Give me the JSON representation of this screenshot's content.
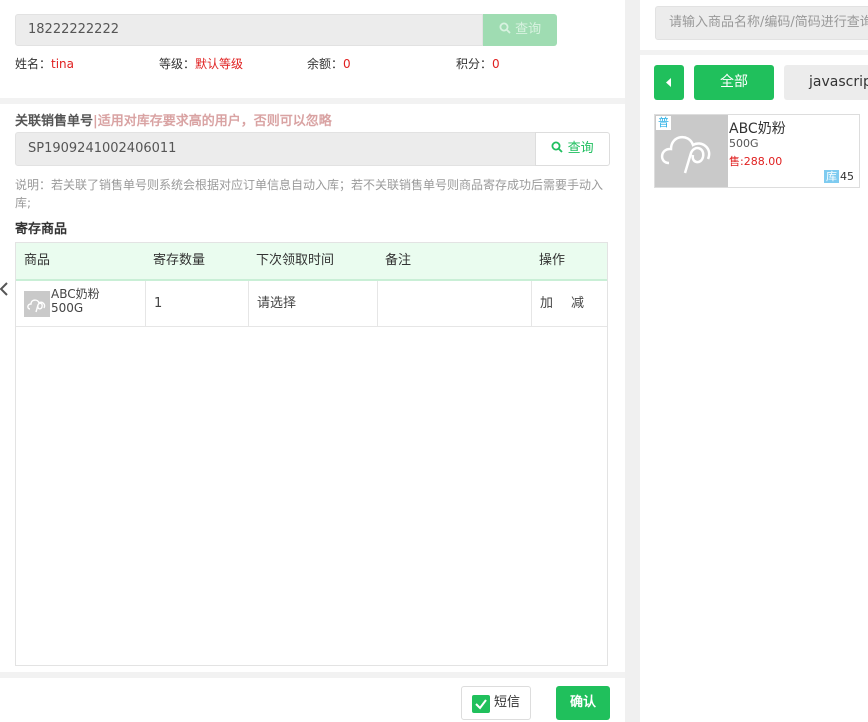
{
  "member": {
    "phone_value": "18222222222",
    "query_label": "查询",
    "name_label": "姓名：",
    "name_value": "tina",
    "level_label": "等级：",
    "level_value": "默认等级",
    "balance_label": "余额：",
    "balance_value": "0",
    "points_label": "积分：",
    "points_value": "0"
  },
  "sales_order": {
    "label": "关联销售单号",
    "hint": "|适用对库存要求高的用户，否则可以忽略",
    "value": "SP1909241002406011",
    "query_label": "查询",
    "note": "说明：若关联了销售单号则系统会根据对应订单信息自动入库；若不关联销售单号则商品寄存成功后需要手动入库;"
  },
  "stored": {
    "title": "寄存商品",
    "headers": [
      "商品",
      "寄存数量",
      "下次领取时间",
      "备注",
      "操作"
    ],
    "rows": [
      {
        "name": "ABC奶粉",
        "spec": "500G",
        "qty": "1",
        "next_time": "请选择",
        "remark": "",
        "add": "加",
        "sub": "减"
      }
    ]
  },
  "footer": {
    "sms_label": "短信",
    "confirm_label": "确认"
  },
  "right": {
    "search_placeholder": "请输入商品名称/编码/简码进行查询",
    "tabs": [
      "全部",
      "javascript"
    ],
    "products": [
      {
        "badge": "普",
        "name": "ABC奶粉",
        "spec": "500G",
        "price": "售:288.00",
        "stock_label": "库",
        "stock": "45"
      }
    ]
  },
  "colors": {
    "accent": "#20c05c",
    "danger": "#e02020",
    "header_bg": "#eafcef"
  },
  "icons": [
    "search-icon",
    "back-arrow-icon",
    "checkbox-checked-icon",
    "triangle-left-icon",
    "cloud-placeholder-icon"
  ]
}
